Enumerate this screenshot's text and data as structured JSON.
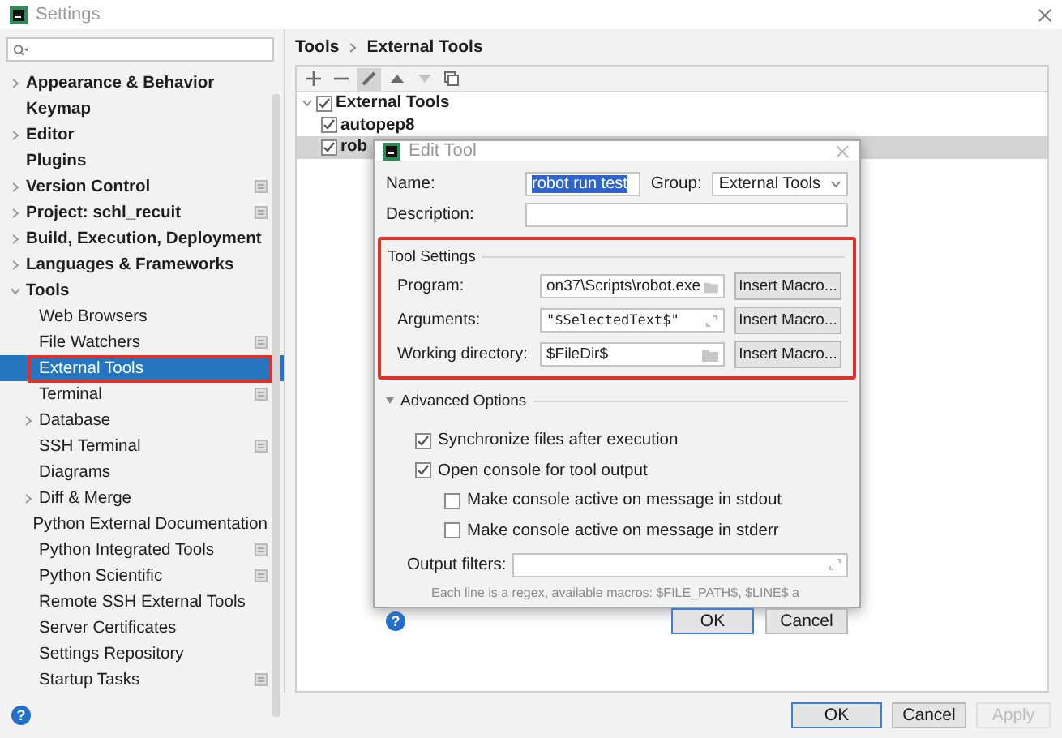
{
  "window": {
    "title": "Settings"
  },
  "help_icon": "?",
  "sidebar": {
    "items": [
      {
        "label": "Appearance & Behavior",
        "expanded": false,
        "selected": false,
        "project_icon": false,
        "highlighted": false
      },
      {
        "label": "Keymap",
        "selected": false,
        "project_icon": false,
        "highlighted": false
      },
      {
        "label": "Editor",
        "expanded": false,
        "selected": false,
        "project_icon": false,
        "highlighted": false
      },
      {
        "label": "Plugins",
        "selected": false,
        "project_icon": false,
        "highlighted": false
      },
      {
        "label": "Version Control",
        "expanded": false,
        "selected": false,
        "project_icon": true,
        "highlighted": false
      },
      {
        "label": "Project: schl_recuit",
        "expanded": false,
        "selected": false,
        "project_icon": true,
        "highlighted": false
      },
      {
        "label": "Build, Execution, Deployment",
        "expanded": false,
        "selected": false,
        "project_icon": false,
        "highlighted": false
      },
      {
        "label": "Languages & Frameworks",
        "expanded": false,
        "selected": false,
        "project_icon": false,
        "highlighted": false
      },
      {
        "label": "Tools",
        "expanded": true,
        "selected": false,
        "project_icon": false,
        "highlighted": false,
        "children": [
          {
            "label": "Web Browsers",
            "selected": false,
            "project_icon": false,
            "highlighted": false
          },
          {
            "label": "File Watchers",
            "selected": false,
            "project_icon": true,
            "highlighted": false
          },
          {
            "label": "External Tools",
            "selected": true,
            "project_icon": false,
            "highlighted": true
          },
          {
            "label": "Terminal",
            "selected": false,
            "project_icon": true,
            "highlighted": false
          },
          {
            "label": "Database",
            "expanded": false,
            "selected": false,
            "project_icon": false,
            "highlighted": false
          },
          {
            "label": "SSH Terminal",
            "selected": false,
            "project_icon": true,
            "highlighted": false
          },
          {
            "label": "Diagrams",
            "selected": false,
            "project_icon": false,
            "highlighted": false
          },
          {
            "label": "Diff & Merge",
            "expanded": false,
            "selected": false,
            "project_icon": false,
            "highlighted": false
          },
          {
            "label": "Python External Documentation",
            "selected": false,
            "project_icon": false,
            "highlighted": false
          },
          {
            "label": "Python Integrated Tools",
            "selected": false,
            "project_icon": true,
            "highlighted": false
          },
          {
            "label": "Python Scientific",
            "selected": false,
            "project_icon": true,
            "highlighted": false
          },
          {
            "label": "Remote SSH External Tools",
            "selected": false,
            "project_icon": false,
            "highlighted": false
          },
          {
            "label": "Server Certificates",
            "selected": false,
            "project_icon": false,
            "highlighted": false
          },
          {
            "label": "Settings Repository",
            "selected": false,
            "project_icon": false,
            "highlighted": false
          },
          {
            "label": "Startup Tasks",
            "selected": false,
            "project_icon": true,
            "highlighted": false
          }
        ]
      }
    ]
  },
  "breadcrumb": [
    "Tools",
    "External Tools"
  ],
  "toolbar": [
    {
      "kind": "add",
      "pressed": false,
      "disabled": false
    },
    {
      "kind": "remove",
      "pressed": false,
      "disabled": false
    },
    {
      "kind": "edit",
      "pressed": true,
      "disabled": false
    },
    {
      "kind": "up",
      "pressed": false,
      "disabled": false
    },
    {
      "kind": "down",
      "pressed": false,
      "disabled": true
    },
    {
      "kind": "copy",
      "pressed": false,
      "disabled": false
    }
  ],
  "tree": [
    {
      "label": "External Tools",
      "expanded": true,
      "checked": true,
      "selected": false,
      "children": [
        {
          "label": "autopep8",
          "checked": true,
          "selected": false
        },
        {
          "label": "rob",
          "checked": true,
          "selected": true
        }
      ]
    }
  ],
  "footer": {
    "buttons": [
      {
        "label": "OK",
        "default": true,
        "disabled": false
      },
      {
        "label": "Cancel",
        "default": false,
        "disabled": false
      },
      {
        "label": "Apply",
        "default": false,
        "disabled": true
      }
    ]
  },
  "dialog": {
    "title": "Edit Tool",
    "name": {
      "label": "Name:",
      "value": "robot run test",
      "text_highlighted": true
    },
    "group": {
      "label": "Group:",
      "value": "External Tools"
    },
    "description": {
      "label": "Description:"
    },
    "help_icon": "?",
    "tool_settings": {
      "title": "Tool Settings",
      "highlighted": true,
      "rows": [
        {
          "label": "Program:",
          "value": "on37\\Scripts\\robot.exe",
          "kind": "folder",
          "button": "Insert Macro..."
        },
        {
          "label": "Arguments:",
          "value": "\"$SelectedText$\"",
          "kind": "expand",
          "button": "Insert Macro..."
        },
        {
          "label": "Working directory:",
          "value": "$FileDir$",
          "kind": "folder",
          "button": "Insert Macro..."
        }
      ]
    },
    "advanced": {
      "title": "Advanced Options",
      "expanded": true,
      "options": [
        {
          "label": "Synchronize files after execution",
          "checked": true
        },
        {
          "label": "Open console for tool output",
          "checked": true,
          "children": [
            {
              "label": "Make console active on message in stdout",
              "checked": false
            },
            {
              "label": "Make console active on message in stderr",
              "checked": false
            }
          ]
        }
      ],
      "output_filters": {
        "label": "Output filters:"
      },
      "hint": "Each line is a regex, available macros: $FILE_PATH$, $LINE$ a"
    },
    "buttons": [
      {
        "label": "OK",
        "default": true
      },
      {
        "label": "Cancel",
        "default": false
      }
    ]
  }
}
